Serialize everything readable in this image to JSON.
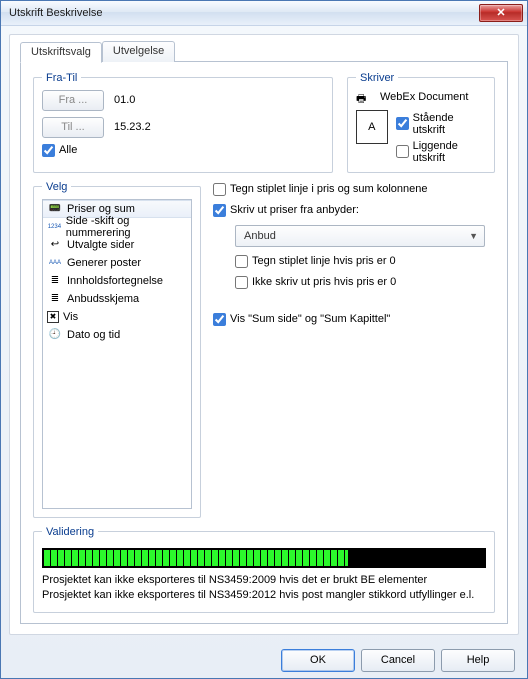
{
  "window": {
    "title": "Utskrift Beskrivelse"
  },
  "tabs": {
    "print": "Utskriftsvalg",
    "select": "Utvelgelse"
  },
  "fratil": {
    "legend": "Fra-Til",
    "fra_btn": "Fra ...",
    "til_btn": "Til ...",
    "fra_val": "01.0",
    "til_val": "15.23.2",
    "alle": "Alle"
  },
  "skriver": {
    "legend": "Skriver",
    "name": "WebEx Document",
    "portrait": "Stående utskrift",
    "landscape": "Liggende utskrift",
    "portrait_checked": true,
    "landscape_checked": false
  },
  "velg": {
    "legend": "Velg",
    "items": [
      {
        "label": "Priser og sum",
        "icon": "calc-icon"
      },
      {
        "label": "Side -skift og nummerering",
        "icon": "numbers-icon"
      },
      {
        "label": "Utvalgte sider",
        "icon": "back-icon"
      },
      {
        "label": "Generer poster",
        "icon": "aaa-icon"
      },
      {
        "label": "Innholdsfortegnelse",
        "icon": "lines-icon"
      },
      {
        "label": "Anbudsskjema",
        "icon": "lines-icon"
      },
      {
        "label": "Vis",
        "icon": "x-icon"
      },
      {
        "label": "Dato og tid",
        "icon": "clock-icon"
      }
    ],
    "selected_index": 0
  },
  "opts": {
    "stiplet_kolonner": "Tegn stiplet linje i pris og sum kolonnene",
    "stiplet_kolonner_checked": false,
    "skriv_priser_anbyder": "Skriv ut priser fra anbyder:",
    "skriv_priser_anbyder_checked": true,
    "anbyder_selected": "Anbud",
    "stiplet_pris0": "Tegn stiplet linje hvis pris er 0",
    "stiplet_pris0_checked": false,
    "ikke_skriv_pris0": "Ikke skriv ut pris hvis pris er 0",
    "ikke_skriv_pris0_checked": false,
    "vis_sumside": "Vis \"Sum side\" og \"Sum Kapittel\"",
    "vis_sumside_checked": true
  },
  "validering": {
    "legend": "Validering",
    "progress_segments": 43,
    "msg1": "Prosjektet kan ikke eksporteres til NS3459:2009 hvis det er brukt BE elementer",
    "msg2": "Prosjektet kan ikke eksporteres til NS3459:2012 hvis post mangler stikkord utfyllinger e.l."
  },
  "buttons": {
    "ok": "OK",
    "cancel": "Cancel",
    "help": "Help"
  },
  "glyphs": {
    "close": "✕",
    "printer": "🖶",
    "calc": "📟",
    "numbers": "1234",
    "back": "↩",
    "aaa": "AAA",
    "lines": "≣",
    "x": "✖",
    "clock": "🕘",
    "portrait_letter": "A",
    "chevron": "▼"
  }
}
